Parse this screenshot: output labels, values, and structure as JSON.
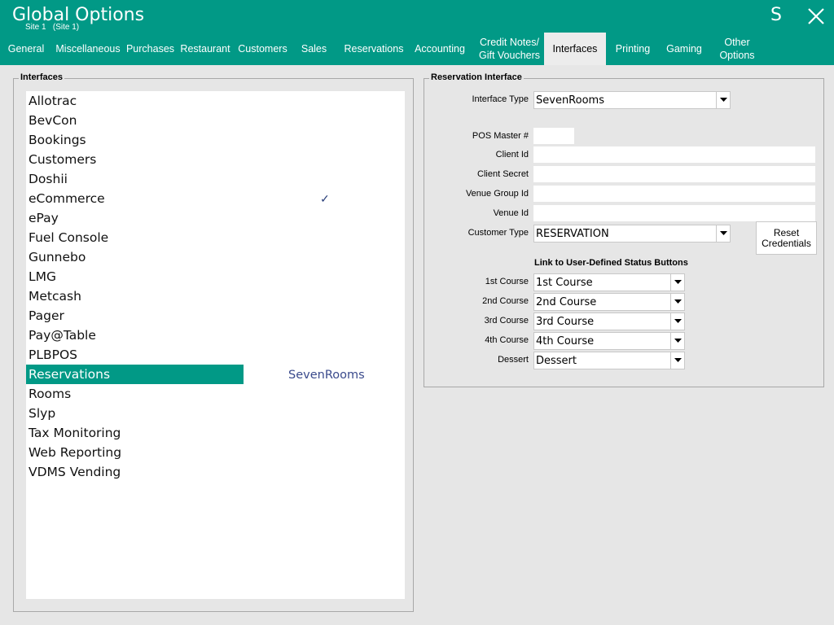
{
  "window": {
    "title": "Global Options",
    "subtitle": "Site 1   (Site 1)",
    "user_initial": "S"
  },
  "tabs": [
    {
      "label": "General"
    },
    {
      "label": "Miscellaneous"
    },
    {
      "label": "Purchases"
    },
    {
      "label": "Restaurant"
    },
    {
      "label": "Customers"
    },
    {
      "label": "Sales"
    },
    {
      "label": "Reservations"
    },
    {
      "label": "Accounting"
    },
    {
      "label": "Credit Notes/\nGift Vouchers"
    },
    {
      "label": "Interfaces"
    },
    {
      "label": "Printing"
    },
    {
      "label": "Gaming"
    },
    {
      "label": "Other\nOptions"
    }
  ],
  "active_tab": "Interfaces",
  "interfaces_panel": {
    "title": "Interfaces",
    "items": [
      {
        "name": "Allotrac"
      },
      {
        "name": "BevCon"
      },
      {
        "name": "Bookings"
      },
      {
        "name": "Customers"
      },
      {
        "name": "Doshii"
      },
      {
        "name": "eCommerce",
        "check": "✓"
      },
      {
        "name": "ePay"
      },
      {
        "name": "Fuel Console"
      },
      {
        "name": "Gunnebo"
      },
      {
        "name": "LMG"
      },
      {
        "name": "Metcash"
      },
      {
        "name": "Pager"
      },
      {
        "name": "Pay@Table"
      },
      {
        "name": "PLBPOS"
      },
      {
        "name": "Reservations",
        "value": "SevenRooms",
        "selected": true
      },
      {
        "name": "Rooms"
      },
      {
        "name": "Slyp"
      },
      {
        "name": "Tax Monitoring"
      },
      {
        "name": "Web Reporting"
      },
      {
        "name": "VDMS Vending"
      }
    ]
  },
  "reservation_interface": {
    "title": "Reservation Interface",
    "interface_type": {
      "label": "Interface Type",
      "value": "SevenRooms"
    },
    "pos_master": {
      "label": "POS Master #",
      "value": ""
    },
    "client_id": {
      "label": "Client Id",
      "value": ""
    },
    "client_secret": {
      "label": "Client Secret",
      "value": ""
    },
    "venue_group_id": {
      "label": "Venue Group Id",
      "value": ""
    },
    "venue_id": {
      "label": "Venue Id",
      "value": ""
    },
    "customer_type": {
      "label": "Customer Type",
      "value": "RESERVATION"
    },
    "reset_button": "Reset\nCredentials",
    "status_section_title": "Link to User-Defined Status Buttons",
    "status_links": [
      {
        "label": "1st Course",
        "value": "1st Course"
      },
      {
        "label": "2nd Course",
        "value": "2nd Course"
      },
      {
        "label": "3rd Course",
        "value": "3rd Course"
      },
      {
        "label": "4th Course",
        "value": "4th Course"
      },
      {
        "label": "Dessert",
        "value": "Dessert"
      }
    ]
  },
  "colors": {
    "accent": "#019986",
    "link_value": "#3a4a8c",
    "background": "#e6e6e6"
  }
}
